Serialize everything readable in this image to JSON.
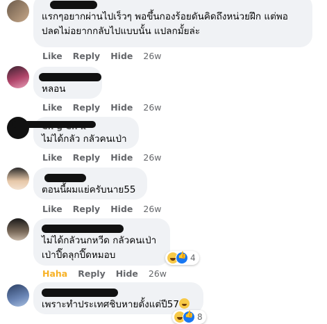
{
  "comments": [
    {
      "name": "",
      "lines": [
        "แรกๆอยากผ่านไปเร็วๆ พอขึ้นกองร้อยดันคิดถึงหน่วยฝึก แต่พอ",
        "ปลดไม่อยากกลับไปแบบนั้น แปลกมั้ยล่ะ"
      ],
      "like": "Like",
      "reply": "Reply",
      "hide": "Hide",
      "time": "26w"
    },
    {
      "name": "",
      "lines": [
        "หลอน"
      ],
      "like": "Like",
      "reply": "Reply",
      "hide": "Hide",
      "time": "26w"
    },
    {
      "name": "Ch          g Ch      k",
      "lines": [
        "ไม่ได้กลัว กลัวคนเป่า"
      ],
      "like": "Like",
      "reply": "Reply",
      "hide": "Hide",
      "time": "26w"
    },
    {
      "name": "",
      "lines": [
        "ตอนนี้ผมแย่ครับนาย55"
      ],
      "like": "Like",
      "reply": "Reply",
      "hide": "Hide",
      "time": "26w"
    },
    {
      "name": "",
      "lines": [
        "ไม่ได้กลัวนกหวีด กลัวคนเป่า",
        "เป่าปี๊ดลุกปี๊ดหมอบ"
      ],
      "like": "Haha",
      "reply": "Reply",
      "hide": "Hide",
      "time": "26w",
      "reaction_count": "4"
    },
    {
      "name": "",
      "lines": [
        "เพราะทำประเทศชิบหายตั้งแต่ปี57"
      ],
      "reaction_count": "8"
    }
  ],
  "colors": {
    "bubble": "#f0f2f5",
    "meta": "#65676b",
    "haha": "#f7b125",
    "like": "#1877f2"
  }
}
